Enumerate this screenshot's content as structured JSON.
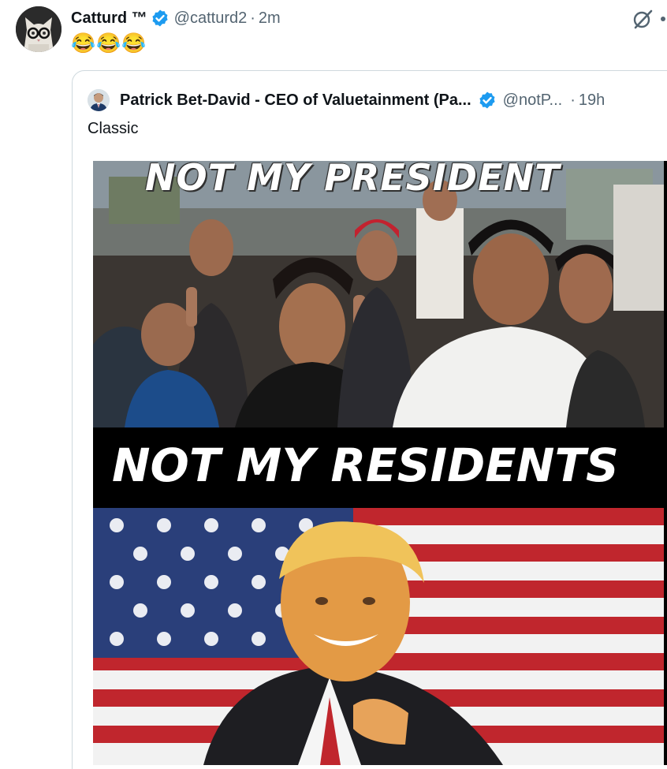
{
  "author": {
    "display_name": "Catturd ™",
    "handle": "@catturd2",
    "separator": "·",
    "time": "2m",
    "verified": true,
    "avatar_icon": "cat-with-glasses-avatar"
  },
  "tweet": {
    "text": "😂😂😂"
  },
  "actions": {
    "grok_icon": "grok-icon",
    "more_icon": "more-icon"
  },
  "quote": {
    "display_name": "Patrick Bet-David - CEO of Valuetainment (Pa...",
    "handle": "@notP...",
    "separator": "·",
    "time": "19h",
    "verified": true,
    "text": "Classic",
    "media": {
      "caption_top": "NOT MY PRESIDENT",
      "caption_bottom": "NOT MY RESIDENTS"
    }
  },
  "colors": {
    "verified_blue": "#1d9bf0",
    "secondary_text": "#536471",
    "border": "#cfd9de"
  }
}
